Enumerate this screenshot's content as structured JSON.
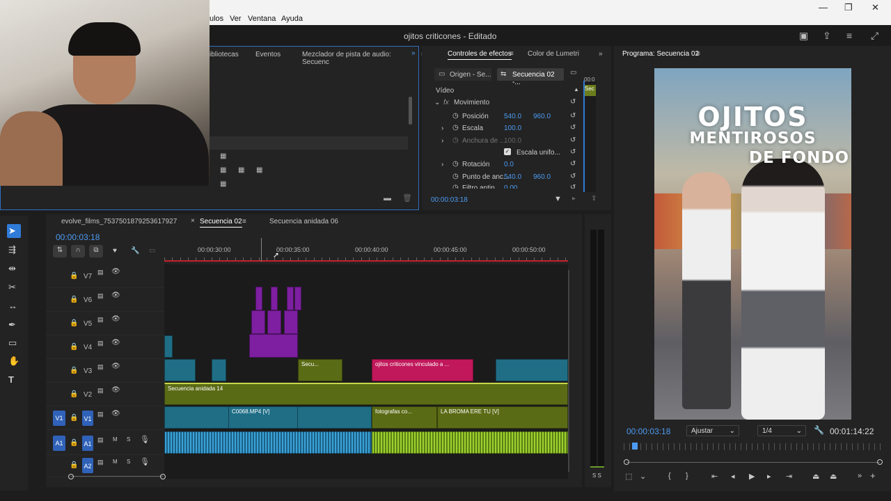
{
  "menu": {
    "items": [
      "ulos",
      "Ver",
      "Ventana",
      "Ayuda"
    ]
  },
  "window": {
    "title": "ojitos criticones - Editado"
  },
  "project_panel": {
    "tabs": [
      "ibliotecas",
      "Eventos",
      "Mezclador de pista de audio: Secuenc",
      "s"
    ]
  },
  "effects_panel": {
    "tabs": [
      "Controles de efectos",
      "Color de Lumetri"
    ],
    "source_tab": "Origen - Se...",
    "seq_tab": "Secuencia 02 -...",
    "video_label": "Vídeo",
    "mini_timeline_label": "Sec",
    "mini_timecode": "00:0",
    "section": "Movimiento",
    "props": [
      {
        "name": "Posición",
        "v1": "540.0",
        "v2": "960.0"
      },
      {
        "name": "Escala",
        "v1": "100.0",
        "v2": ""
      },
      {
        "name": "Anchura de ...",
        "v1": "100.0",
        "v2": ""
      },
      {
        "name": "Escala unifo...",
        "v1": "",
        "v2": ""
      },
      {
        "name": "Rotación",
        "v1": "0.0",
        "v2": ""
      },
      {
        "name": "Punto de anc...",
        "v1": "540.0",
        "v2": "960.0"
      },
      {
        "name": "Filtro antip...",
        "v1": "0.00",
        "v2": ""
      }
    ],
    "timecode": "00:00:03:18"
  },
  "program_monitor": {
    "title": "Programa: Secuencia 02",
    "overlay_line1": "OJITOS",
    "overlay_line2": "MENTIROSOS",
    "overlay_line3": "DE FONDO",
    "timecode": "00:00:03:18",
    "fit": "Ajustar",
    "resolution": "1/4",
    "duration": "00:01:14:22"
  },
  "timeline": {
    "tabs": [
      "evolve_films_7537501879253617927",
      "Secuencia 02",
      "Secuencia anidada 06"
    ],
    "timecode": "00:00:03:18",
    "ruler": [
      "00:00:30:00",
      "00:00:35:00",
      "00:00:40:00",
      "00:00:45:00",
      "00:00:50:00"
    ],
    "tracks": [
      "V7",
      "V6",
      "V5",
      "V4",
      "V3",
      "V2",
      "V1",
      "A1",
      "A2"
    ],
    "source_patch": [
      "V1",
      "A1"
    ],
    "clips": {
      "v3_a": "Secu...",
      "v3_b": "ojitos criticones vinculado a ...",
      "v2": "Secuencia anidada 14",
      "v1_a": "C0068.MP4 [V]",
      "v1_b": "fotografas co...",
      "v1_c": "LA BROMA ERE TU [V]"
    },
    "audio_labels": {
      "m": "M",
      "s": "S"
    },
    "meter_label": "S S"
  },
  "colors": {
    "accent": "#4c9bf2",
    "v_clip": "#1f6e86",
    "purple": "#7d1fa0",
    "pink": "#c1185b",
    "olive": "#5a6b16",
    "green_audio": "#8cc22a"
  }
}
